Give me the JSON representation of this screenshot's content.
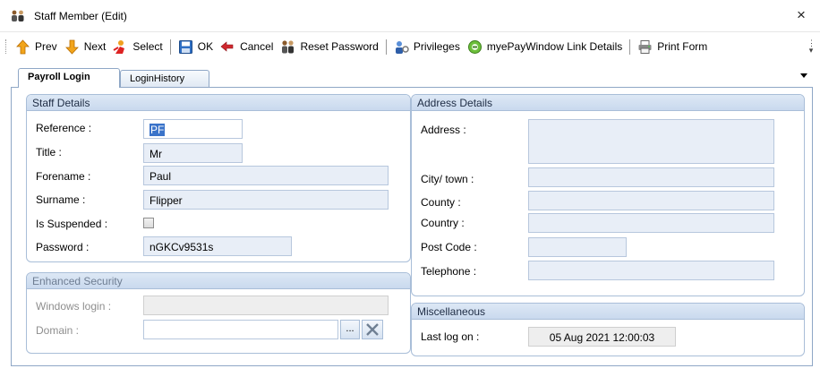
{
  "window": {
    "title": "Staff Member (Edit)",
    "close_glyph": "×"
  },
  "toolbar": {
    "prev": "Prev",
    "next": "Next",
    "select": "Select",
    "ok": "OK",
    "cancel": "Cancel",
    "reset_password": "Reset Password",
    "privileges": "Privileges",
    "mye_link": "myePayWindow Link Details",
    "print_form": "Print Form"
  },
  "tabs": [
    {
      "label": "Payroll Login",
      "active": true
    },
    {
      "label": "LoginHistory",
      "active": false
    }
  ],
  "staff_details": {
    "header": "Staff Details",
    "reference_label": "Reference :",
    "reference_value": "PF",
    "title_label": "Title :",
    "title_value": "Mr",
    "forename_label": "Forename :",
    "forename_value": "Paul",
    "surname_label": "Surname :",
    "surname_value": "Flipper",
    "suspended_label": "Is Suspended :",
    "suspended_checked": false,
    "password_label": "Password :",
    "password_value": "nGKCv9531s"
  },
  "enhanced_security": {
    "header": "Enhanced Security",
    "windows_login_label": "Windows login :",
    "windows_login_value": "",
    "domain_label": "Domain :",
    "domain_value": "",
    "browse_label": "..."
  },
  "address_details": {
    "header": "Address Details",
    "address_label": "Address :",
    "address_value": "",
    "city_label": "City/ town :",
    "city_value": "",
    "county_label": "County :",
    "county_value": "",
    "country_label": "Country :",
    "country_value": "",
    "postcode_label": "Post Code :",
    "postcode_value": "",
    "telephone_label": "Telephone :",
    "telephone_value": ""
  },
  "miscellaneous": {
    "header": "Miscellaneous",
    "last_logon_label": "Last log on :",
    "last_logon_value": "05 Aug 2021 12:00:03"
  },
  "colors": {
    "group_border": "#a9bed8",
    "field_fill": "#e8eef7",
    "selection": "#3a73c9"
  }
}
